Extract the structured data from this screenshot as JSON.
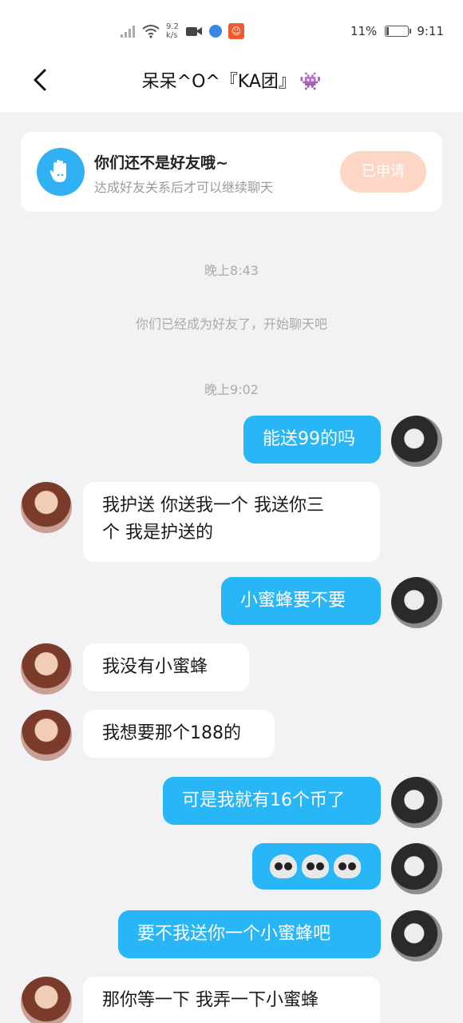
{
  "status_bar": {
    "net_speed_value": "9.2",
    "net_speed_unit": "k/s",
    "battery_percent": "11%",
    "battery_level": 0.11,
    "time": "9:11",
    "icons": [
      "signal-icon",
      "wifi-icon",
      "video-icon",
      "browser-icon",
      "app-badge-icon",
      "battery-icon"
    ]
  },
  "header": {
    "back_icon": "chevron-left-icon",
    "title": "呆呆^O^『KA团』",
    "title_emoji": "👾"
  },
  "friend_card": {
    "title": "你们还不是好友哦~",
    "subtitle": "达成好友关系后才可以继续聊天",
    "button_label": "已申请",
    "button_color": "#fdd6c6"
  },
  "system": {
    "time_1": "晚上8:43",
    "friend_notice": "你们已经成为好友了，开始聊天吧",
    "time_2": "晚上9:02"
  },
  "messages": [
    {
      "side": "right",
      "text": "能送99的吗"
    },
    {
      "side": "left",
      "lines": [
        "我护送 你送我一个 我送你三",
        "个 我是护送的"
      ]
    },
    {
      "side": "right",
      "text": "小蜜蜂要不要"
    },
    {
      "side": "left",
      "text": "我没有小蜜蜂"
    },
    {
      "side": "left",
      "text": "我想要那个188的"
    },
    {
      "side": "right",
      "text": "可是我就有16个币了"
    },
    {
      "side": "right",
      "emoji": "skull-emoji x3"
    },
    {
      "side": "right",
      "text": "要不我送你一个小蜜蜂吧"
    },
    {
      "side": "left",
      "text": "那你等一下 我弄一下小蜜蜂"
    }
  ],
  "colors": {
    "outgoing_bubble": "#29b6f6",
    "incoming_bubble": "#ffffff",
    "background": "#f2f2f5"
  }
}
